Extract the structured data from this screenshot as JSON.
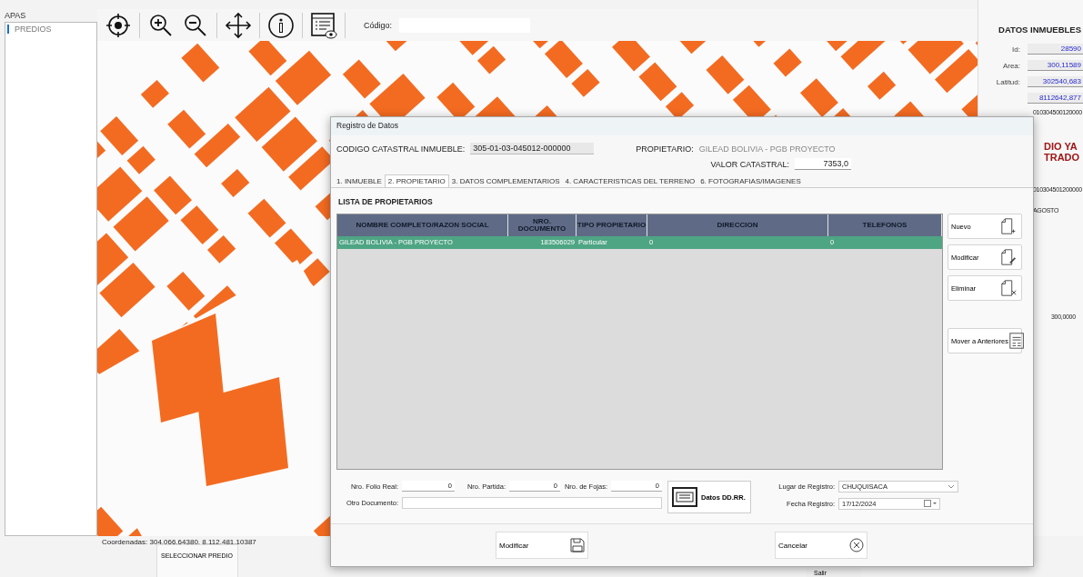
{
  "sidebar": {
    "header": "APAS",
    "items": [
      {
        "label": "PREDIOS",
        "selected": true
      }
    ]
  },
  "toolbar": {
    "code_label": "Código:"
  },
  "map": {
    "coordinates": "Coordenadas: 304.066,64380, 8.112.481,10387"
  },
  "info_panel": {
    "title": "DATOS INMUEBLES",
    "fields": [
      {
        "label": "Id:",
        "value": "28590"
      },
      {
        "label": "Area:",
        "value": "300,11589"
      },
      {
        "label": "Latitud:",
        "value": "302540,683"
      },
      {
        "value": "8112642,877"
      }
    ],
    "code": "010304500120000",
    "notice": [
      "DIO YA",
      "TRADO"
    ],
    "code_2": "010304501200000",
    "month": "AGOSTO",
    "amount": "300,0000"
  },
  "bottom_bar": {
    "select_button": "SELECCIONAR PREDIO",
    "exit_button": "Salir"
  },
  "dialog": {
    "title": "Registro de Datos",
    "cadastral_code_label": "CODIGO CATASTRAL INMUEBLE:",
    "cadastral_code": "305-01-03-045012-000000",
    "owner_label": "PROPIETARIO:",
    "owner": "GILEAD BOLIVIA - PGB PROYECTO",
    "value_label": "VALOR CATASTRAL:",
    "value": "7353,0",
    "tabs": [
      {
        "label": "1. INMUEBLE",
        "selected": false
      },
      {
        "label": "2. PROPIETARIO",
        "selected": true
      },
      {
        "label": "3. DATOS COMPLEMENTARIOS",
        "selected": false
      },
      {
        "label": "4. CARACTERISTICAS DEL TERRENO",
        "selected": false
      },
      {
        "label": "6. FOTOGRAFIAS/IMAGENES",
        "selected": false
      }
    ],
    "list_title": "LISTA DE PROPIETARIOS",
    "table": {
      "columns": [
        "NOMBRE COMPLETO/RAZON SOCIAL",
        "NRO. DOCUMENTO",
        "TIPO PROPIETARIO",
        "DIRECCION",
        "TELEFONOS"
      ],
      "rows": [
        {
          "cells": [
            "GILEAD BOLIVIA - PGB PROYECTO",
            "183506029",
            "Particular",
            "0",
            "0"
          ],
          "selected": true
        }
      ]
    },
    "side_buttons": [
      {
        "label": "Nuevo",
        "kind": "new"
      },
      {
        "label": "Modificar",
        "kind": "edit"
      },
      {
        "label": "Eliminar",
        "kind": "delete"
      },
      {
        "label": "Mover a Anteriores",
        "kind": "move"
      }
    ],
    "folio_label": "Nro. Folio Real:",
    "folio": "0",
    "partida_label": "Nro. Partida:",
    "partida": "0",
    "fojas_label": "Nro. de Fojas:",
    "fojas": "0",
    "other_doc_label": "Otro Documento:",
    "ddrr_button": "Datos DD.RR.",
    "place_label": "Lugar de Registro:",
    "place": "CHUQUISACA",
    "date_label": "Fecha Registro:",
    "date": "17/12/2024",
    "footer_buttons": [
      {
        "label": "Modificar",
        "kind": "save"
      },
      {
        "label": "Cancelar",
        "kind": "cancel"
      }
    ]
  }
}
